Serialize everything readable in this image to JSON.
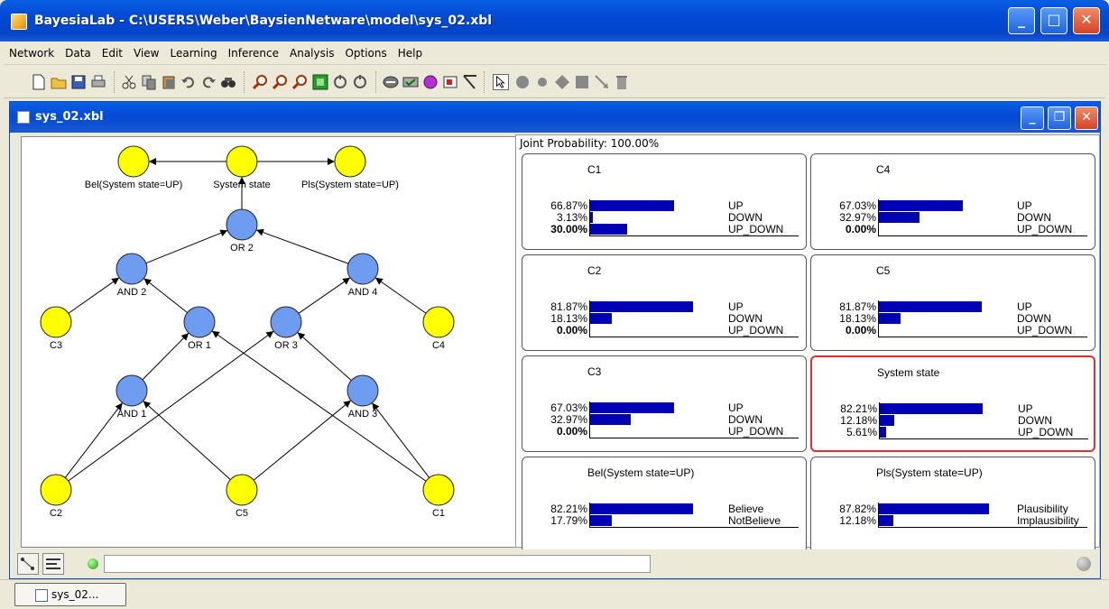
{
  "window": {
    "title": "BayesiaLab - C:\\USERS\\Weber\\BaysienNetware\\model\\sys_02.xbl"
  },
  "menu": [
    "Network",
    "Data",
    "Edit",
    "View",
    "Learning",
    "Inference",
    "Analysis",
    "Options",
    "Help"
  ],
  "document": {
    "title": "sys_02.xbl"
  },
  "graph": {
    "nodes": [
      {
        "id": "bel",
        "label": "Bel(System state=UP)",
        "color": "#ffff00"
      },
      {
        "id": "sys",
        "label": "System state",
        "color": "#ffff00"
      },
      {
        "id": "pls",
        "label": "Pls(System state=UP)",
        "color": "#ffff00"
      },
      {
        "id": "or2",
        "label": "OR 2",
        "color": "#6e9cf0"
      },
      {
        "id": "and2",
        "label": "AND 2",
        "color": "#6e9cf0"
      },
      {
        "id": "and4",
        "label": "AND 4",
        "color": "#6e9cf0"
      },
      {
        "id": "c3",
        "label": "C3",
        "color": "#ffff00"
      },
      {
        "id": "or1",
        "label": "OR 1",
        "color": "#6e9cf0"
      },
      {
        "id": "or3",
        "label": "OR 3",
        "color": "#6e9cf0"
      },
      {
        "id": "c4",
        "label": "C4",
        "color": "#ffff00"
      },
      {
        "id": "and1",
        "label": "AND 1",
        "color": "#6e9cf0"
      },
      {
        "id": "and3",
        "label": "AND 3",
        "color": "#6e9cf0"
      },
      {
        "id": "c2",
        "label": "C2",
        "color": "#ffff00"
      },
      {
        "id": "c5",
        "label": "C5",
        "color": "#ffff00"
      },
      {
        "id": "c1",
        "label": "C1",
        "color": "#ffff00"
      }
    ],
    "edges": [
      [
        "sys",
        "bel"
      ],
      [
        "sys",
        "pls"
      ],
      [
        "or2",
        "sys"
      ],
      [
        "and2",
        "or2"
      ],
      [
        "and4",
        "or2"
      ],
      [
        "c3",
        "and2"
      ],
      [
        "or1",
        "and2"
      ],
      [
        "or3",
        "and4"
      ],
      [
        "c4",
        "and4"
      ],
      [
        "and1",
        "or1"
      ],
      [
        "c1",
        "or1"
      ],
      [
        "c2",
        "or3"
      ],
      [
        "and3",
        "or3"
      ],
      [
        "c2",
        "and1"
      ],
      [
        "c5",
        "and1"
      ],
      [
        "c5",
        "and3"
      ],
      [
        "c1",
        "and3"
      ]
    ]
  },
  "monitors": {
    "joint_label": "Joint Probability: 100.00%",
    "items": [
      {
        "title": "C1",
        "rows": [
          {
            "pct": "66.87%",
            "value": 66.87,
            "state": "UP"
          },
          {
            "pct": "3.13%",
            "value": 3.13,
            "state": "DOWN"
          },
          {
            "pct": "30.00%",
            "value": 30.0,
            "state": "UP_DOWN",
            "bold": true
          }
        ]
      },
      {
        "title": "C4",
        "rows": [
          {
            "pct": "67.03%",
            "value": 67.03,
            "state": "UP"
          },
          {
            "pct": "32.97%",
            "value": 32.97,
            "state": "DOWN"
          },
          {
            "pct": "0.00%",
            "value": 0.0,
            "state": "UP_DOWN",
            "bold": true
          }
        ]
      },
      {
        "title": "C2",
        "rows": [
          {
            "pct": "81.87%",
            "value": 81.87,
            "state": "UP"
          },
          {
            "pct": "18.13%",
            "value": 18.13,
            "state": "DOWN"
          },
          {
            "pct": "0.00%",
            "value": 0.0,
            "state": "UP_DOWN",
            "bold": true
          }
        ]
      },
      {
        "title": "C5",
        "rows": [
          {
            "pct": "81.87%",
            "value": 81.87,
            "state": "UP"
          },
          {
            "pct": "18.13%",
            "value": 18.13,
            "state": "DOWN"
          },
          {
            "pct": "0.00%",
            "value": 0.0,
            "state": "UP_DOWN",
            "bold": true
          }
        ]
      },
      {
        "title": "C3",
        "rows": [
          {
            "pct": "67.03%",
            "value": 67.03,
            "state": "UP"
          },
          {
            "pct": "32.97%",
            "value": 32.97,
            "state": "DOWN"
          },
          {
            "pct": "0.00%",
            "value": 0.0,
            "state": "UP_DOWN",
            "bold": true
          }
        ]
      },
      {
        "title": "System state",
        "selected": true,
        "rows": [
          {
            "pct": "82.21%",
            "value": 82.21,
            "state": "UP"
          },
          {
            "pct": "12.18%",
            "value": 12.18,
            "state": "DOWN"
          },
          {
            "pct": "5.61%",
            "value": 5.61,
            "state": "UP_DOWN"
          }
        ]
      },
      {
        "title": "Bel(System state=UP)",
        "rows": [
          {
            "pct": "82.21%",
            "value": 82.21,
            "state": "Believe"
          },
          {
            "pct": "17.79%",
            "value": 17.79,
            "state": "NotBelieve"
          }
        ]
      },
      {
        "title": "Pls(System state=UP)",
        "rows": [
          {
            "pct": "87.82%",
            "value": 87.82,
            "state": "Plausibility"
          },
          {
            "pct": "12.18%",
            "value": 12.18,
            "state": "Implausibility"
          }
        ]
      }
    ]
  },
  "taskbar": {
    "item_label": "sys_02..."
  },
  "colors": {
    "bar": "#0000b4",
    "selected_border": "#e03030",
    "yellow_node": "#ffff00",
    "blue_node": "#6e9cf0"
  }
}
